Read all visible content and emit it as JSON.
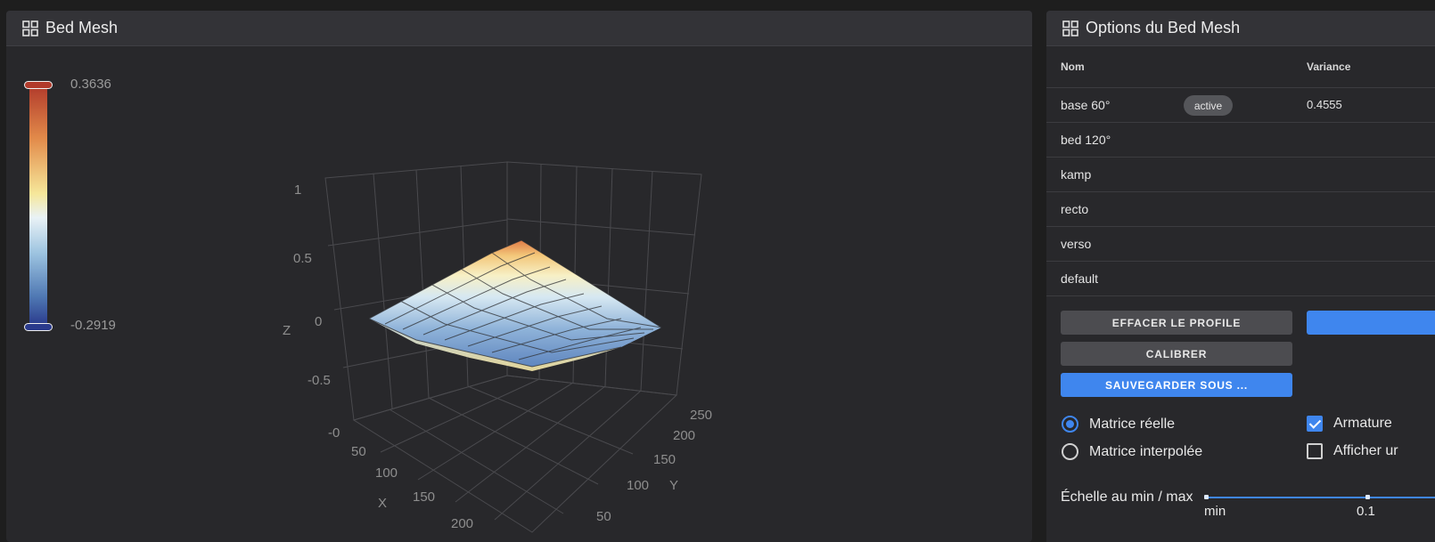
{
  "left_panel": {
    "title": "Bed Mesh",
    "color_scale": {
      "max": "0.3636",
      "min": "-0.2919"
    },
    "axes": {
      "z_label": "Z",
      "x_label": "X",
      "y_label": "Y",
      "z_ticks": [
        "1",
        "0.5",
        "0",
        "-0.5",
        "-0"
      ],
      "x_ticks": [
        "50",
        "100",
        "150",
        "200"
      ],
      "y_ticks": [
        "250",
        "200",
        "150",
        "100",
        "50"
      ]
    }
  },
  "right_panel": {
    "title": "Options du Bed Mesh",
    "table": {
      "col_name": "Nom",
      "col_variance": "Variance",
      "rows": [
        {
          "name": "base 60°",
          "badge": "active",
          "variance": "0.4555"
        },
        {
          "name": "bed 120°",
          "badge": "",
          "variance": ""
        },
        {
          "name": "kamp",
          "badge": "",
          "variance": ""
        },
        {
          "name": "recto",
          "badge": "",
          "variance": ""
        },
        {
          "name": "verso",
          "badge": "",
          "variance": ""
        },
        {
          "name": "default",
          "badge": "",
          "variance": ""
        }
      ]
    },
    "buttons": {
      "clear": "EFFACER LE PROFILE",
      "calibrate": "CALIBRER",
      "save_as": "SAUVEGARDER SOUS ..."
    },
    "options": {
      "real_matrix": "Matrice réelle",
      "interpolated_matrix": "Matrice interpolée",
      "wireframe": "Armature",
      "show": "Afficher ur"
    },
    "scale": {
      "label": "Échelle au min / max",
      "min_label": "min",
      "max_label": "0.1"
    }
  },
  "colors": {
    "accent": "#3f86ee",
    "panel": "#28282b",
    "background": "#1e1e1e"
  }
}
